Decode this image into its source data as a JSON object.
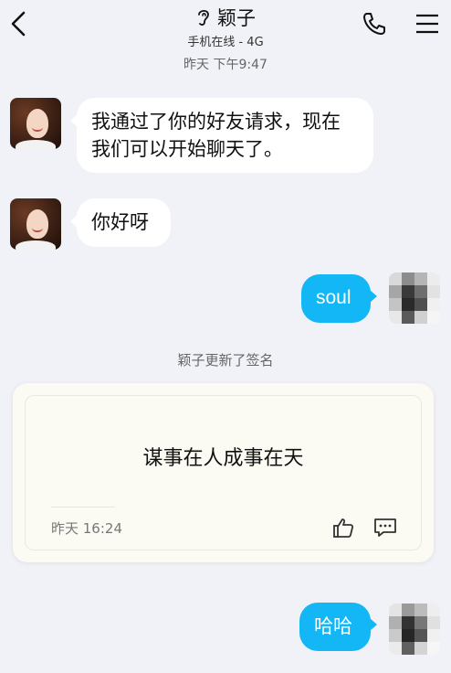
{
  "header": {
    "title": "颖子",
    "status": "手机在线 - 4G",
    "back_icon": "chevron-left-icon",
    "ear_icon": "ear-icon",
    "phone_icon": "phone-icon",
    "menu_icon": "menu-icon"
  },
  "chat": {
    "timestamp": "昨天  下午9:47",
    "messages": [
      {
        "side": "left",
        "text": "我通过了你的好友请求，现在我们可以开始聊天了。"
      },
      {
        "side": "left",
        "text": "你好呀"
      },
      {
        "side": "right",
        "text": "soul"
      },
      {
        "side": "right",
        "text": "哈哈"
      }
    ],
    "system_note": "颖子更新了签名",
    "signature_card": {
      "text": "谋事在人成事在天",
      "time": "昨天 16:24",
      "like_icon": "thumbs-up-icon",
      "comment_icon": "comment-icon"
    }
  },
  "colors": {
    "background": "#f1f2f7",
    "outgoing_bubble": "#14b7f5",
    "incoming_bubble": "#ffffff",
    "card_background": "#fbfbf3"
  }
}
